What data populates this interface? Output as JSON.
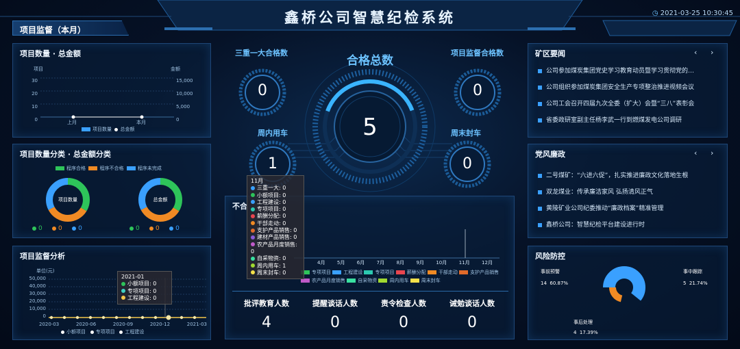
{
  "header": {
    "title": "鑫桥公司智慧纪检系统",
    "datetime": "2021-03-25 10:30:45"
  },
  "module_tab": "项目监督（本月）",
  "count_panel": {
    "title": "项目数量 · 总金额",
    "left_axis_title": "项目",
    "right_axis_title": "金额",
    "left_ticks": [
      "30",
      "20",
      "10",
      "0"
    ],
    "right_ticks": [
      "15,000",
      "10,000",
      "5,000",
      "0"
    ],
    "x_labels": [
      "上月",
      "本月"
    ],
    "legend": [
      "项目数量",
      "总金额"
    ]
  },
  "category_panel": {
    "title": "项目数量分类 · 总金额分类",
    "legend": [
      "程序合格",
      "程序不合格",
      "程序未完成"
    ],
    "donut1_label": "项目数量",
    "donut2_label": "总金额",
    "donut1_values": [
      "0",
      "0",
      "0"
    ],
    "donut2_values": [
      "0",
      "0",
      "0"
    ]
  },
  "analysis_panel": {
    "title": "项目监督分析",
    "unit": "单位(元)",
    "y_ticks": [
      "50,000",
      "40,000",
      "30,000",
      "20,000",
      "10,000",
      "0"
    ],
    "x_labels": [
      "2020-03",
      "2020-06",
      "2020-09",
      "2020-12",
      "2021-03"
    ],
    "legend": [
      "小额项目",
      "专项项目",
      "工程建设"
    ],
    "tooltip": {
      "title": "2021-01",
      "rows": [
        "小额项目: 0",
        "专项项目: 0",
        "工程建设: 0"
      ]
    }
  },
  "center": {
    "total_label": "合格总数",
    "total_value": "5",
    "top_left_label": "三重一大合格数",
    "top_left_value": "0",
    "top_right_label": "项目监督合格数",
    "top_right_value": "0",
    "bottom_left_label": "周内用车",
    "bottom_left_value": "1",
    "bottom_right_label": "周末封车",
    "bottom_right_value": "0"
  },
  "unqualified_panel": {
    "title": "不合",
    "x_labels": [
      "4月",
      "5月",
      "6月",
      "7月",
      "8月",
      "9月",
      "10月",
      "11月",
      "12月"
    ],
    "legend_row1": [
      "专项项目",
      "工程建设",
      "专项项目",
      "薪酬分配",
      "干部走动",
      "支护产品销售"
    ],
    "legend_row2": [
      "农产品月度销售",
      "自采物资",
      "周内用车",
      "周末封车"
    ],
    "tooltip": {
      "title": "11月",
      "rows": [
        "三重一大: 0",
        "小额项目: 0",
        "工程建设: 0",
        "专项项目: 0",
        "薪酬分配: 0",
        "干部走动: 0",
        "支护产品销售: 0",
        "建材产品销售: 0",
        "农产品月度销售: 0",
        "自采物资: 0",
        "周内用车: 1",
        "周末封车: 0"
      ]
    },
    "stats": [
      {
        "label": "批评教育人数",
        "value": "4"
      },
      {
        "label": "提醒谈话人数",
        "value": "0"
      },
      {
        "label": "责令检查人数",
        "value": "0"
      },
      {
        "label": "诫勉谈话人数",
        "value": "0"
      }
    ]
  },
  "news_panel": {
    "title": "矿区要闻",
    "items": [
      "公司参加煤炭集团党史学习教育动员暨学习贯彻党的…",
      "公司组织参加煤炭集团安全生产专项整治推进视频会议",
      "公司工会召开四届九次全委（扩大）会暨“三八”表彰会",
      "省委政研室副主任杨李武一行到燃煤发电公司调研"
    ]
  },
  "party_panel": {
    "title": "党风廉政",
    "items": [
      "二号煤矿：“六进六促”，扎实推进廉政文化落地生根",
      "双龙煤业：传承廉洁家风 弘扬清风正气",
      "黄陵矿业公司纪委推动“廉政档案”精准管理",
      "鑫桥公司：智慧纪检平台建设进行时"
    ]
  },
  "risk_panel": {
    "title": "风险防控",
    "pre": {
      "label": "事前预警",
      "count": "14",
      "pct": "60.87%"
    },
    "mid": {
      "label": "事中跟踪",
      "count": "5",
      "pct": "21.74%"
    },
    "post": {
      "label": "事后处理",
      "count": "4",
      "pct": "17.39%"
    }
  },
  "colors": {
    "accent": "#3aa0ff",
    "green": "#2ec45a",
    "orange": "#f08a24",
    "blue": "#3aa0ff",
    "yellow": "#f4c64a"
  }
}
